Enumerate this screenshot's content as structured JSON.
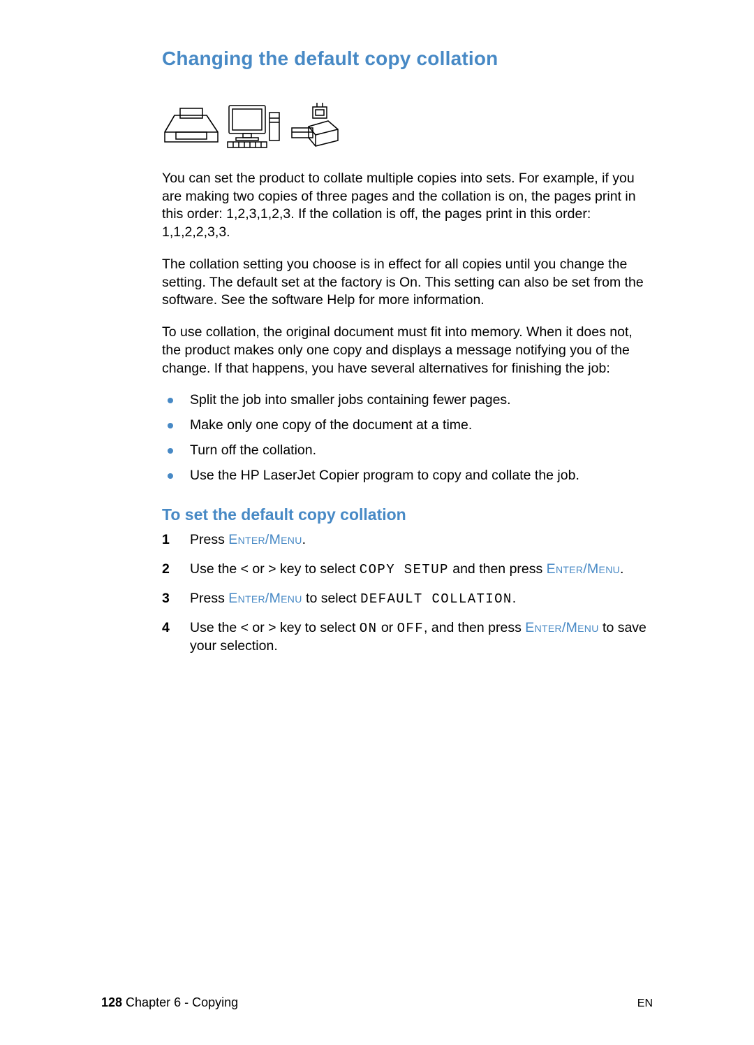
{
  "heading": "Changing the default copy collation",
  "para1": "You can set the product to collate multiple copies into sets. For example, if you are making two copies of three pages and the collation is on, the pages print in this order: 1,2,3,1,2,3. If the collation is off, the pages print in this order: 1,1,2,2,3,3.",
  "para2": "The collation setting you choose is in effect for all copies until you change the setting. The default set at the factory is On. This setting can also be set from the software. See the software Help for more information.",
  "para3": "To use collation, the original document must fit into memory. When it does not, the product makes only one copy and displays a message notifying you of the change. If that happens, you have several alternatives for finishing the job:",
  "bullets": [
    "Split the job into smaller jobs containing fewer pages.",
    "Make only one copy of the document at a time.",
    "Turn off the collation.",
    "Use the HP LaserJet Copier program to copy and collate the job."
  ],
  "subheading": "To set the default copy collation",
  "step1": {
    "a": "Press ",
    "key1": "Enter/Menu",
    "b": "."
  },
  "step2": {
    "a": "Use the < or > key to select ",
    "lcd1": "COPY SETUP",
    "b": " and then press ",
    "key1": "Enter/Menu",
    "c": "."
  },
  "step3": {
    "a": "Press ",
    "key1": "Enter/Menu",
    "b": " to select ",
    "lcd1": "DEFAULT COLLATION",
    "c": "."
  },
  "step4": {
    "a": "Use the < or > key to select ",
    "lcd1": "ON",
    "b": " or ",
    "lcd2": "OFF",
    "c": ", and then press ",
    "key1": "Enter/Menu",
    "d": " to save your selection."
  },
  "footer": {
    "pagenum": "128",
    "chapter": " Chapter 6 - Copying",
    "lang": "EN"
  }
}
